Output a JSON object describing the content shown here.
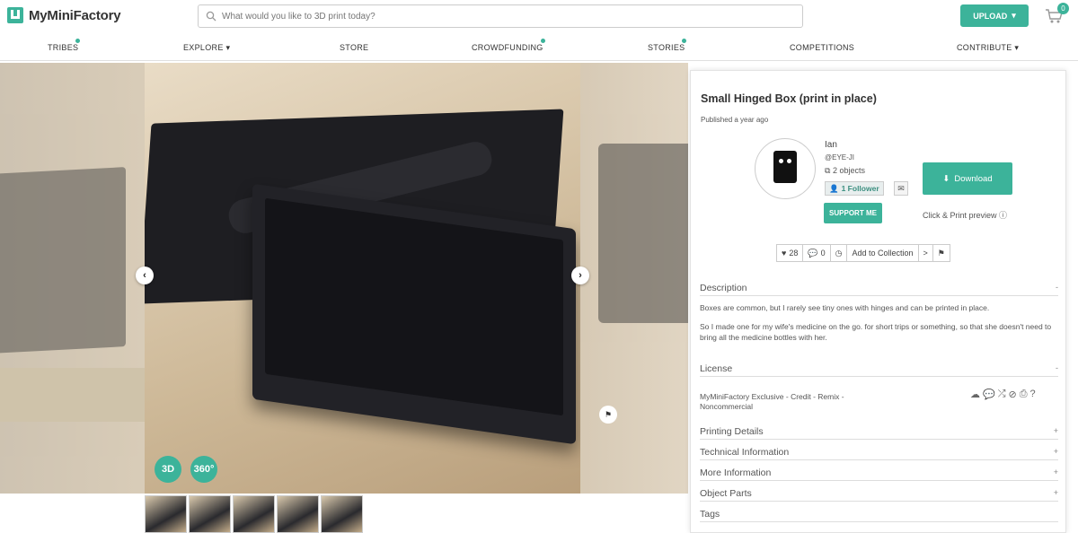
{
  "header": {
    "logo_text": "MyMiniFactory",
    "search_placeholder": "What would you like to 3D print today?",
    "upload_label": "UPLOAD",
    "cart_count": "0"
  },
  "nav": {
    "items": [
      {
        "label": "TRIBES",
        "dot": true
      },
      {
        "label": "EXPLORE",
        "dropdown": true
      },
      {
        "label": "STORE"
      },
      {
        "label": "CROWDFUNDING",
        "dot": true
      },
      {
        "label": "STORIES",
        "dot": true
      },
      {
        "label": "COMPETITIONS"
      },
      {
        "label": "CONTRIBUTE",
        "dropdown": true
      }
    ]
  },
  "gallery": {
    "badge_3d": "3D",
    "badge_360": "360°",
    "thumb_count": 5
  },
  "object": {
    "title": "Small Hinged Box (print in place)",
    "published": "Published a year ago"
  },
  "user": {
    "name": "Ian",
    "handle": "@EYE-JI",
    "objects": "2 objects",
    "followers": "1 Follower",
    "support_label": "SUPPORT ME"
  },
  "download": {
    "label": "Download",
    "preview_label": "Click & Print preview"
  },
  "actions": {
    "likes": "28",
    "comments": "0",
    "collection_label": "Add to Collection"
  },
  "sections": {
    "description": {
      "label": "Description",
      "toggle": "-",
      "paragraph1": "Boxes are common, but I rarely see tiny ones with hinges and can be printed in place.",
      "paragraph2": "So I made one for my wife's medicine on the go.  for short trips or something, so that she doesn't need to bring all the medicine bottles with her."
    },
    "license": {
      "label": "License",
      "toggle": "-",
      "text": "MyMiniFactory Exclusive - Credit - Remix - Noncommercial"
    },
    "printing": {
      "label": "Printing Details",
      "toggle": "+"
    },
    "technical": {
      "label": "Technical Information",
      "toggle": "+"
    },
    "more": {
      "label": "More Information",
      "toggle": "+"
    },
    "parts": {
      "label": "Object Parts",
      "toggle": "+"
    },
    "tags": {
      "label": "Tags"
    }
  },
  "colors": {
    "accent": "#3cb39a"
  }
}
